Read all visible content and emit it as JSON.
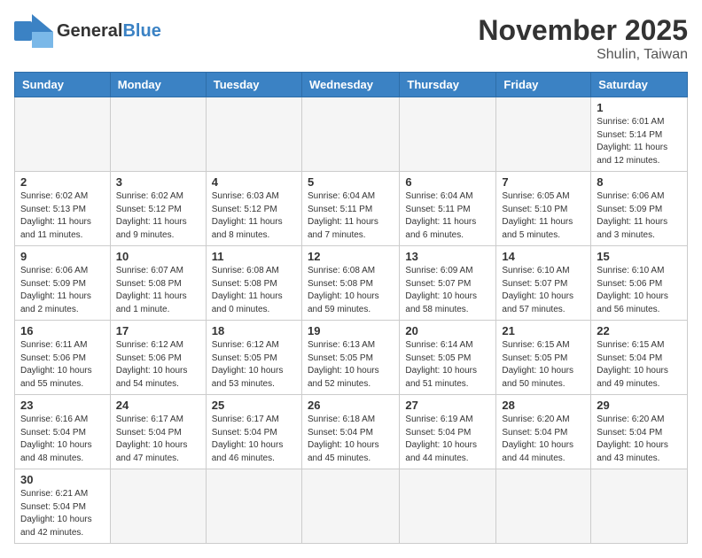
{
  "header": {
    "logo_general": "General",
    "logo_blue": "Blue",
    "month_title": "November 2025",
    "location": "Shulin, Taiwan"
  },
  "weekdays": [
    "Sunday",
    "Monday",
    "Tuesday",
    "Wednesday",
    "Thursday",
    "Friday",
    "Saturday"
  ],
  "weeks": [
    [
      {
        "day": "",
        "sunrise": "",
        "sunset": "",
        "daylight": ""
      },
      {
        "day": "",
        "sunrise": "",
        "sunset": "",
        "daylight": ""
      },
      {
        "day": "",
        "sunrise": "",
        "sunset": "",
        "daylight": ""
      },
      {
        "day": "",
        "sunrise": "",
        "sunset": "",
        "daylight": ""
      },
      {
        "day": "",
        "sunrise": "",
        "sunset": "",
        "daylight": ""
      },
      {
        "day": "",
        "sunrise": "",
        "sunset": "",
        "daylight": ""
      },
      {
        "day": "1",
        "sunrise": "Sunrise: 6:01 AM",
        "sunset": "Sunset: 5:14 PM",
        "daylight": "Daylight: 11 hours and 12 minutes."
      }
    ],
    [
      {
        "day": "2",
        "sunrise": "Sunrise: 6:02 AM",
        "sunset": "Sunset: 5:13 PM",
        "daylight": "Daylight: 11 hours and 11 minutes."
      },
      {
        "day": "3",
        "sunrise": "Sunrise: 6:02 AM",
        "sunset": "Sunset: 5:12 PM",
        "daylight": "Daylight: 11 hours and 9 minutes."
      },
      {
        "day": "4",
        "sunrise": "Sunrise: 6:03 AM",
        "sunset": "Sunset: 5:12 PM",
        "daylight": "Daylight: 11 hours and 8 minutes."
      },
      {
        "day": "5",
        "sunrise": "Sunrise: 6:04 AM",
        "sunset": "Sunset: 5:11 PM",
        "daylight": "Daylight: 11 hours and 7 minutes."
      },
      {
        "day": "6",
        "sunrise": "Sunrise: 6:04 AM",
        "sunset": "Sunset: 5:11 PM",
        "daylight": "Daylight: 11 hours and 6 minutes."
      },
      {
        "day": "7",
        "sunrise": "Sunrise: 6:05 AM",
        "sunset": "Sunset: 5:10 PM",
        "daylight": "Daylight: 11 hours and 5 minutes."
      },
      {
        "day": "8",
        "sunrise": "Sunrise: 6:06 AM",
        "sunset": "Sunset: 5:09 PM",
        "daylight": "Daylight: 11 hours and 3 minutes."
      }
    ],
    [
      {
        "day": "9",
        "sunrise": "Sunrise: 6:06 AM",
        "sunset": "Sunset: 5:09 PM",
        "daylight": "Daylight: 11 hours and 2 minutes."
      },
      {
        "day": "10",
        "sunrise": "Sunrise: 6:07 AM",
        "sunset": "Sunset: 5:08 PM",
        "daylight": "Daylight: 11 hours and 1 minute."
      },
      {
        "day": "11",
        "sunrise": "Sunrise: 6:08 AM",
        "sunset": "Sunset: 5:08 PM",
        "daylight": "Daylight: 11 hours and 0 minutes."
      },
      {
        "day": "12",
        "sunrise": "Sunrise: 6:08 AM",
        "sunset": "Sunset: 5:08 PM",
        "daylight": "Daylight: 10 hours and 59 minutes."
      },
      {
        "day": "13",
        "sunrise": "Sunrise: 6:09 AM",
        "sunset": "Sunset: 5:07 PM",
        "daylight": "Daylight: 10 hours and 58 minutes."
      },
      {
        "day": "14",
        "sunrise": "Sunrise: 6:10 AM",
        "sunset": "Sunset: 5:07 PM",
        "daylight": "Daylight: 10 hours and 57 minutes."
      },
      {
        "day": "15",
        "sunrise": "Sunrise: 6:10 AM",
        "sunset": "Sunset: 5:06 PM",
        "daylight": "Daylight: 10 hours and 56 minutes."
      }
    ],
    [
      {
        "day": "16",
        "sunrise": "Sunrise: 6:11 AM",
        "sunset": "Sunset: 5:06 PM",
        "daylight": "Daylight: 10 hours and 55 minutes."
      },
      {
        "day": "17",
        "sunrise": "Sunrise: 6:12 AM",
        "sunset": "Sunset: 5:06 PM",
        "daylight": "Daylight: 10 hours and 54 minutes."
      },
      {
        "day": "18",
        "sunrise": "Sunrise: 6:12 AM",
        "sunset": "Sunset: 5:05 PM",
        "daylight": "Daylight: 10 hours and 53 minutes."
      },
      {
        "day": "19",
        "sunrise": "Sunrise: 6:13 AM",
        "sunset": "Sunset: 5:05 PM",
        "daylight": "Daylight: 10 hours and 52 minutes."
      },
      {
        "day": "20",
        "sunrise": "Sunrise: 6:14 AM",
        "sunset": "Sunset: 5:05 PM",
        "daylight": "Daylight: 10 hours and 51 minutes."
      },
      {
        "day": "21",
        "sunrise": "Sunrise: 6:15 AM",
        "sunset": "Sunset: 5:05 PM",
        "daylight": "Daylight: 10 hours and 50 minutes."
      },
      {
        "day": "22",
        "sunrise": "Sunrise: 6:15 AM",
        "sunset": "Sunset: 5:04 PM",
        "daylight": "Daylight: 10 hours and 49 minutes."
      }
    ],
    [
      {
        "day": "23",
        "sunrise": "Sunrise: 6:16 AM",
        "sunset": "Sunset: 5:04 PM",
        "daylight": "Daylight: 10 hours and 48 minutes."
      },
      {
        "day": "24",
        "sunrise": "Sunrise: 6:17 AM",
        "sunset": "Sunset: 5:04 PM",
        "daylight": "Daylight: 10 hours and 47 minutes."
      },
      {
        "day": "25",
        "sunrise": "Sunrise: 6:17 AM",
        "sunset": "Sunset: 5:04 PM",
        "daylight": "Daylight: 10 hours and 46 minutes."
      },
      {
        "day": "26",
        "sunrise": "Sunrise: 6:18 AM",
        "sunset": "Sunset: 5:04 PM",
        "daylight": "Daylight: 10 hours and 45 minutes."
      },
      {
        "day": "27",
        "sunrise": "Sunrise: 6:19 AM",
        "sunset": "Sunset: 5:04 PM",
        "daylight": "Daylight: 10 hours and 44 minutes."
      },
      {
        "day": "28",
        "sunrise": "Sunrise: 6:20 AM",
        "sunset": "Sunset: 5:04 PM",
        "daylight": "Daylight: 10 hours and 44 minutes."
      },
      {
        "day": "29",
        "sunrise": "Sunrise: 6:20 AM",
        "sunset": "Sunset: 5:04 PM",
        "daylight": "Daylight: 10 hours and 43 minutes."
      }
    ],
    [
      {
        "day": "30",
        "sunrise": "Sunrise: 6:21 AM",
        "sunset": "Sunset: 5:04 PM",
        "daylight": "Daylight: 10 hours and 42 minutes."
      },
      {
        "day": "",
        "sunrise": "",
        "sunset": "",
        "daylight": ""
      },
      {
        "day": "",
        "sunrise": "",
        "sunset": "",
        "daylight": ""
      },
      {
        "day": "",
        "sunrise": "",
        "sunset": "",
        "daylight": ""
      },
      {
        "day": "",
        "sunrise": "",
        "sunset": "",
        "daylight": ""
      },
      {
        "day": "",
        "sunrise": "",
        "sunset": "",
        "daylight": ""
      },
      {
        "day": "",
        "sunrise": "",
        "sunset": "",
        "daylight": ""
      }
    ]
  ]
}
